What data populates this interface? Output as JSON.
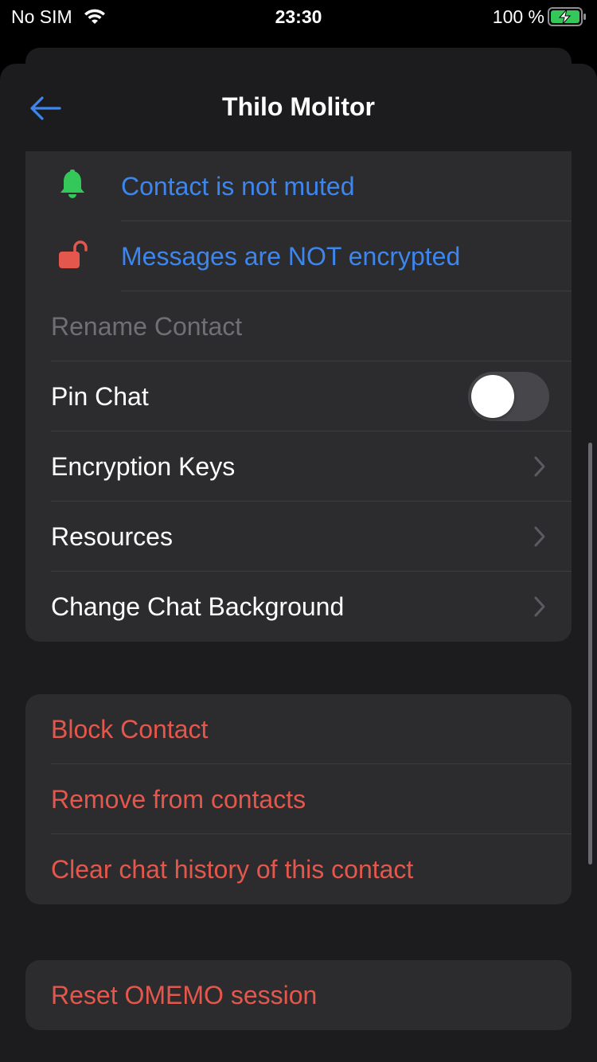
{
  "status_bar": {
    "carrier": "No SIM",
    "time": "23:30",
    "battery_percent": "100 %"
  },
  "nav": {
    "title": "Thilo Molitor",
    "back_icon": "arrow-left-icon"
  },
  "details": {
    "mute_status": "Contact is not muted",
    "mute_icon": "bell-icon",
    "encryption_status": "Messages are NOT encrypted",
    "encryption_icon": "unlocked-padlock-icon",
    "rename_label": "Rename Contact",
    "pin_chat_label": "Pin Chat",
    "pin_chat_enabled": false,
    "encryption_keys_label": "Encryption Keys",
    "resources_label": "Resources",
    "change_background_label": "Change Chat Background"
  },
  "danger_actions": {
    "block_label": "Block Contact",
    "remove_label": "Remove from contacts",
    "clear_history_label": "Clear chat history of this contact"
  },
  "omemo": {
    "reset_label": "Reset OMEMO session"
  },
  "colors": {
    "accent": "#3d86ee",
    "danger": "#e4574c",
    "bell": "#34c759",
    "lock": "#e4574c"
  }
}
